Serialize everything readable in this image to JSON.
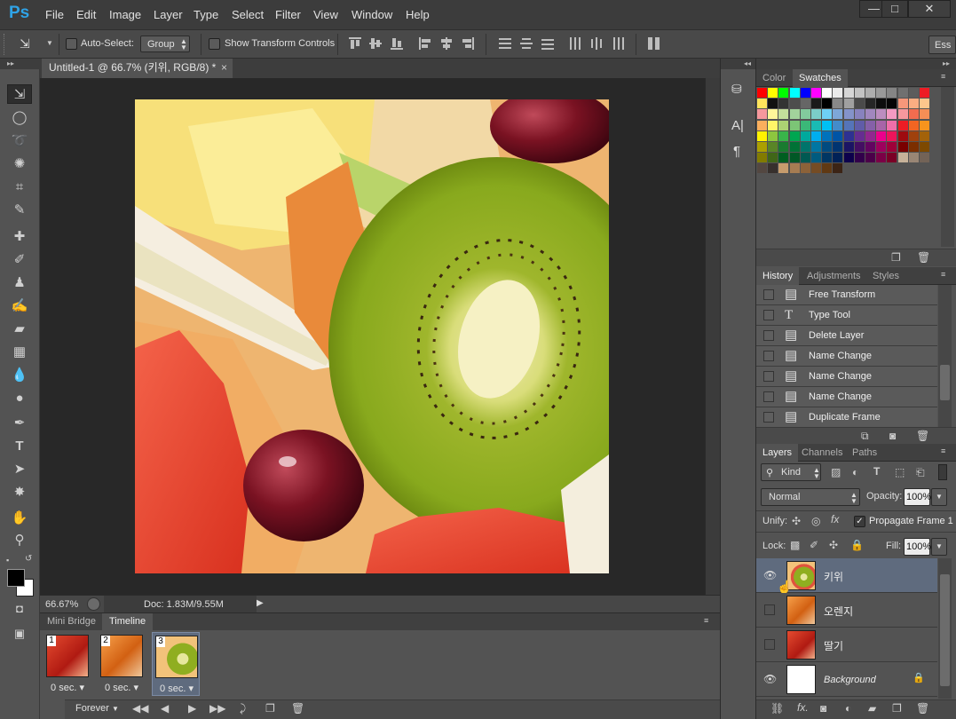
{
  "app": {
    "logo": "Ps"
  },
  "menu": [
    "File",
    "Edit",
    "Image",
    "Layer",
    "Type",
    "Select",
    "Filter",
    "View",
    "Window",
    "Help"
  ],
  "window_controls": {
    "minimize": "—",
    "maximize": "□",
    "close": "✕"
  },
  "options_bar": {
    "auto_select_label": "Auto-Select:",
    "auto_select_value": "Group",
    "transform_label": "Show Transform Controls",
    "workspace_label": "Ess"
  },
  "document": {
    "tab_title": "Untitled-1 @ 66.7% (키위, RGB/8) *",
    "zoom": "66.67%",
    "doc_size": "Doc: 1.83M/9.55M"
  },
  "timeline": {
    "tabs": [
      "Mini Bridge",
      "Timeline"
    ],
    "frames": [
      {
        "num": "1",
        "delay": "0 sec.",
        "thumb": "strawberry"
      },
      {
        "num": "2",
        "delay": "0 sec.",
        "thumb": "orange"
      },
      {
        "num": "3",
        "delay": "0 sec.",
        "thumb": "kiwi"
      }
    ],
    "loop": "Forever"
  },
  "color_panel": {
    "tabs": [
      "Color",
      "Swatches"
    ]
  },
  "swatches": [
    "#ff0000",
    "#ffff00",
    "#00ff00",
    "#00ffff",
    "#0000ff",
    "#ff00ff",
    "#ffffff",
    "#ebebeb",
    "#d6d6d6",
    "#c2c2c2",
    "#adadad",
    "#999999",
    "#858585",
    "#707070",
    "#5c5c5c",
    "#ed1c24",
    "#ffe45c",
    "#111111",
    "#333333",
    "#4d4d4d",
    "#666666",
    "#1a1a1a",
    "#000000",
    "#888888",
    "#a0a0a0",
    "#4a4a4a",
    "#262626",
    "#0d0d0d",
    "#050505",
    "#f7977a",
    "#fbad82",
    "#fdc68c",
    "#f6989d",
    "#fff79a",
    "#c4df9b",
    "#a2d39c",
    "#82ca9d",
    "#7bcdc8",
    "#6ecff6",
    "#7ea7d8",
    "#8493ca",
    "#8882be",
    "#a187be",
    "#bc8dbf",
    "#f49ac2",
    "#f6989d",
    "#f26c4f",
    "#f68e56",
    "#fbaf5d",
    "#fff568",
    "#acd373",
    "#7cc576",
    "#3bb878",
    "#1abbb4",
    "#00bff3",
    "#438ccb",
    "#5574b9",
    "#605ca8",
    "#8560a8",
    "#a864a8",
    "#f06eaa",
    "#ed1c24",
    "#f26522",
    "#f7941d",
    "#fff200",
    "#8dc63f",
    "#39b54a",
    "#00a651",
    "#00a99d",
    "#00aeef",
    "#0072bc",
    "#0054a6",
    "#2e3192",
    "#662d91",
    "#92278f",
    "#ec008c",
    "#ed145b",
    "#9e0b0f",
    "#a0410d",
    "#a36209",
    "#aba000",
    "#598527",
    "#1a7b30",
    "#007236",
    "#00746b",
    "#0076a3",
    "#004b80",
    "#003471",
    "#1b1464",
    "#440e62",
    "#630460",
    "#9e005d",
    "#9e0039",
    "#790000",
    "#7b2e00",
    "#7d4900",
    "#827b00",
    "#406618",
    "#005e20",
    "#005826",
    "#005952",
    "#005b7f",
    "#003663",
    "#002157",
    "#0d004c",
    "#32004b",
    "#4b0049",
    "#7b0046",
    "#7a0026",
    "#c7b299",
    "#998675",
    "#736357",
    "#534741",
    "#37302d",
    "#c69c6d",
    "#a67c52",
    "#8c6239",
    "#754c24",
    "#603913",
    "#3c2415"
  ],
  "history": {
    "tabs": [
      "History",
      "Adjustments",
      "Styles"
    ],
    "items": [
      {
        "label": "Free Transform",
        "icon": "doc-icon"
      },
      {
        "label": "Type Tool",
        "icon": "type-icon"
      },
      {
        "label": "Delete Layer",
        "icon": "doc-icon"
      },
      {
        "label": "Name Change",
        "icon": "doc-icon"
      },
      {
        "label": "Name Change",
        "icon": "doc-icon"
      },
      {
        "label": "Name Change",
        "icon": "doc-icon"
      },
      {
        "label": "Duplicate Frame",
        "icon": "doc-icon"
      }
    ]
  },
  "layers": {
    "tabs": [
      "Layers",
      "Channels",
      "Paths"
    ],
    "filter_kind": "Kind",
    "blend_mode": "Normal",
    "opacity_label": "Opacity:",
    "opacity": "100%",
    "unify_label": "Unify:",
    "propagate_label": "Propagate Frame 1",
    "lock_label": "Lock:",
    "fill_label": "Fill:",
    "fill": "100%",
    "items": [
      {
        "name": "키위",
        "visible": true,
        "selected": true,
        "thumb": "kiwi"
      },
      {
        "name": "오렌지",
        "visible": false,
        "selected": false,
        "thumb": "orange"
      },
      {
        "name": "딸기",
        "visible": false,
        "selected": false,
        "thumb": "strawberry"
      },
      {
        "name": "Background",
        "visible": true,
        "selected": false,
        "thumb": "white",
        "locked": true
      }
    ]
  },
  "colors": {
    "accent": "#2fa3e7",
    "selected_layer": "#5f6b7e",
    "fg_swatch": "#000000",
    "bg_swatch": "#ffffff"
  }
}
